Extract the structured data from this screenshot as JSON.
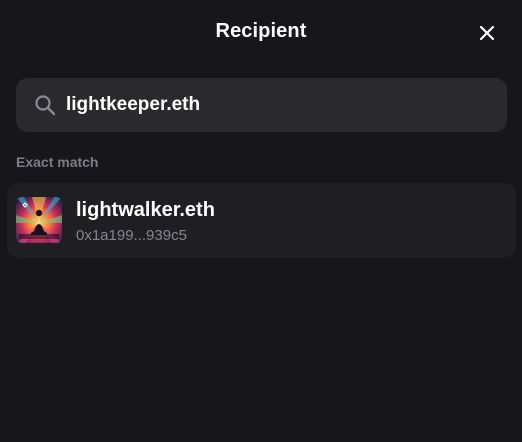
{
  "header": {
    "title": "Recipient",
    "close_icon": "close-icon"
  },
  "search": {
    "value": "lightkeeper.eth",
    "icon": "search-icon"
  },
  "results": {
    "section_label": "Exact match",
    "items": [
      {
        "name": "lightwalker.eth",
        "address": "0x1a199...939c5",
        "avatar": "ens-avatar"
      }
    ]
  },
  "colors": {
    "background": "#17171b",
    "search_bg": "#2a2a2e",
    "row_bg": "#1f1f23",
    "muted_text": "#7c7c83"
  }
}
